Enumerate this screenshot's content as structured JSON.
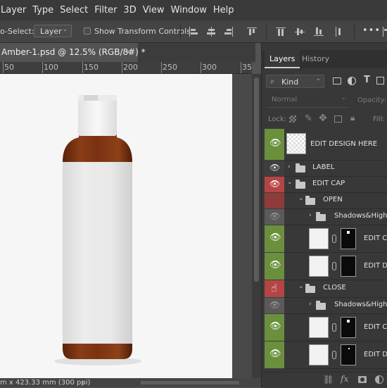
{
  "menubar": {
    "items": [
      "Layer",
      "Type",
      "Select",
      "Filter",
      "3D",
      "View",
      "Window",
      "Help"
    ]
  },
  "options": {
    "auto_select_label": "o-Select:",
    "auto_select_value": "Layer",
    "transform_label": "Show Transform Controls",
    "more": "•••"
  },
  "document": {
    "tab_title": "Amber-1.psd @ 12.5% (RGB/8#) *",
    "close": "×",
    "ruler_numbers": [
      "50",
      "100",
      "150",
      "200",
      "250",
      "300",
      "35"
    ],
    "status": "m x 423.33 mm (300 ppi)",
    "status_arrow": "›"
  },
  "panel": {
    "tabs": [
      "Layers",
      "History"
    ],
    "active_tab": "Layers",
    "filter_value": "Kind",
    "blend_mode": "Normal",
    "opacity_label": "Opacity:",
    "lock_label": "Lock:",
    "fill_label": "Fill:",
    "layers": [
      {
        "name": "EDIT DESIGN HERE",
        "eye": "green",
        "type": "smart"
      },
      {
        "name": "LABEL",
        "eye": "none",
        "type": "group",
        "indent": 0,
        "arrow": "›"
      },
      {
        "name": "EDIT CAP",
        "eye": "red",
        "type": "group",
        "indent": 0,
        "arrow": "⌄"
      },
      {
        "name": "OPEN",
        "eye": "red",
        "type": "group",
        "indent": 1,
        "arrow": "⌄"
      },
      {
        "name": "Shadows&Highligh",
        "eye": "gray",
        "type": "group",
        "indent": 2,
        "arrow": "›"
      },
      {
        "name": "EDIT CA",
        "eye": "green",
        "type": "masked"
      },
      {
        "name": "EDIT DI",
        "eye": "green",
        "type": "masked"
      },
      {
        "name": "CLOSE",
        "eye": "red",
        "type": "group",
        "indent": 1,
        "arrow": "⌄"
      },
      {
        "name": "Shadows&Highligh",
        "eye": "gray",
        "type": "group",
        "indent": 2,
        "arrow": "›"
      },
      {
        "name": "EDIT CA",
        "eye": "green",
        "type": "masked"
      },
      {
        "name": "EDIT DI",
        "eye": "green",
        "type": "masked"
      }
    ],
    "footer_icons": [
      "link-icon",
      "fx-icon",
      "mask-icon",
      "adjustment-icon"
    ]
  },
  "colors": {
    "eye_green": "#6a8f3d",
    "eye_red": "#b54545",
    "bottle_amber": "#7a3414",
    "label_white": "#e9e9e9"
  }
}
